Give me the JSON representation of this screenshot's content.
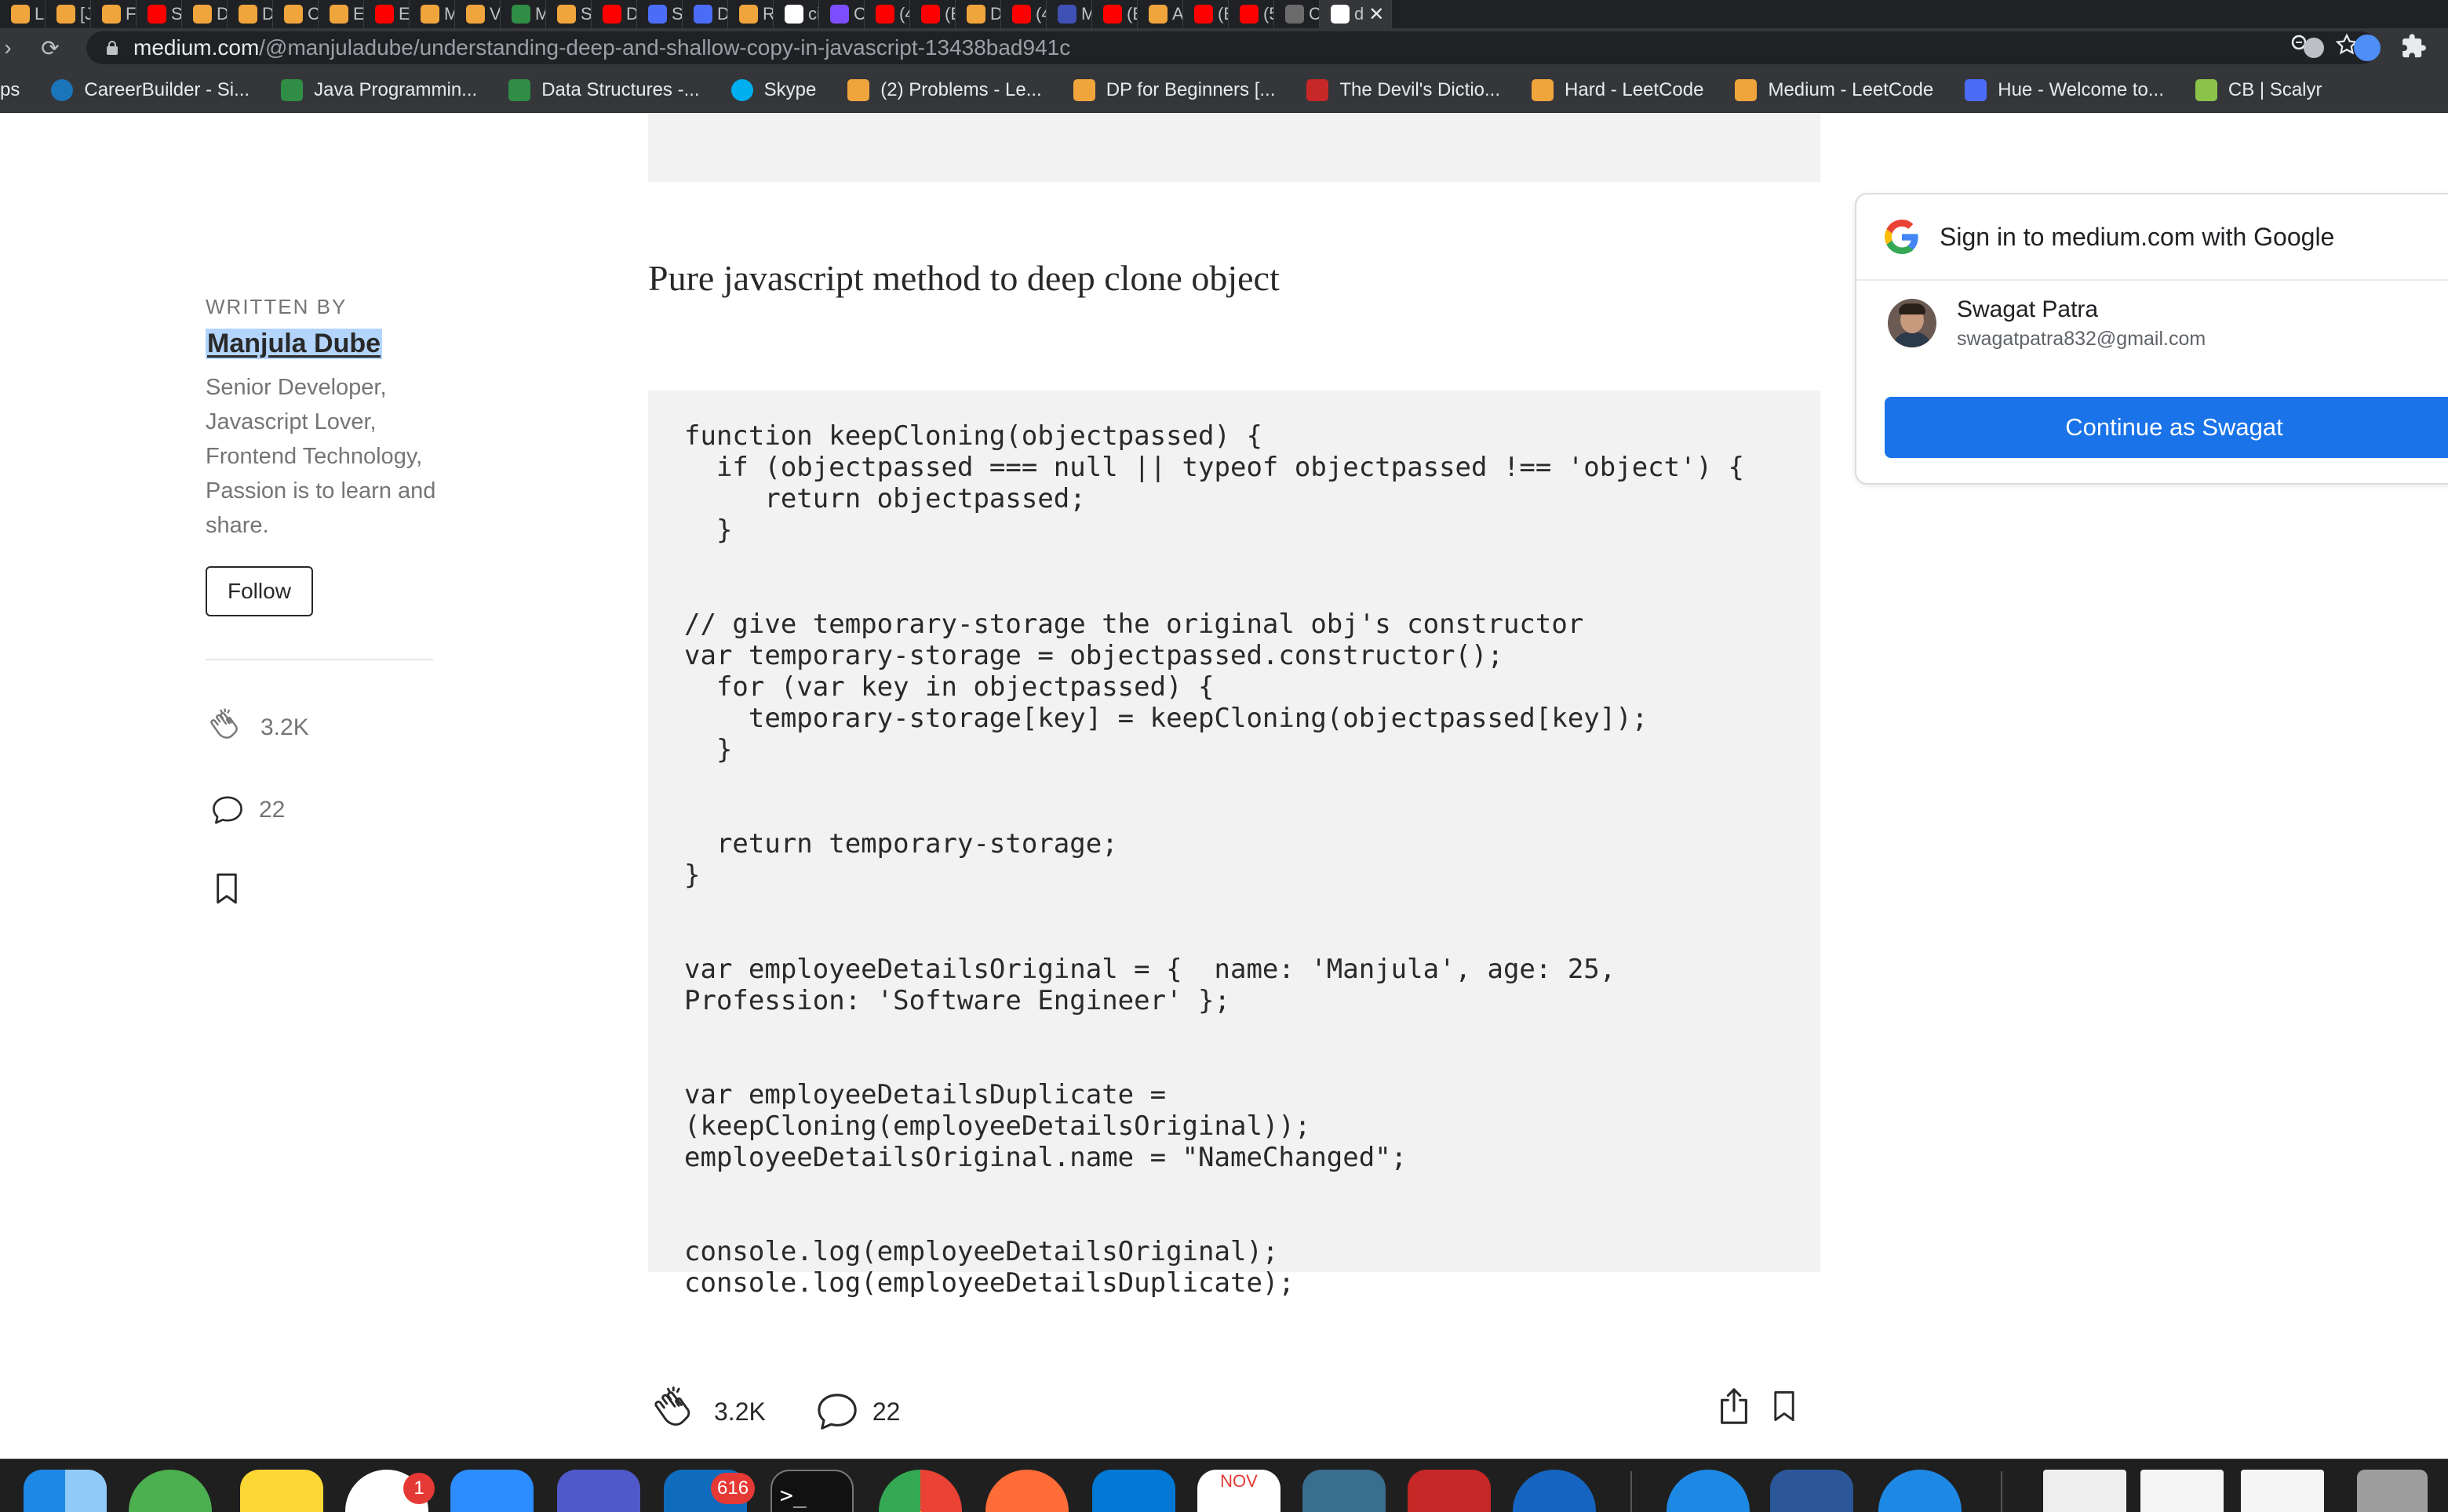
{
  "browser": {
    "tabs": [
      {
        "label": "LI",
        "color": "#f0a53c"
      },
      {
        "label": "[J",
        "color": "#f0a53c"
      },
      {
        "label": "Fi",
        "color": "#f0a53c"
      },
      {
        "label": "St",
        "color": "#ff0000"
      },
      {
        "label": "D",
        "color": "#f0a53c"
      },
      {
        "label": "D",
        "color": "#f0a53c"
      },
      {
        "label": "C",
        "color": "#f0a53c"
      },
      {
        "label": "Er",
        "color": "#f0a53c"
      },
      {
        "label": "Er",
        "color": "#ff0000"
      },
      {
        "label": "M",
        "color": "#f0a53c"
      },
      {
        "label": "Vi",
        "color": "#f0a53c"
      },
      {
        "label": "M",
        "color": "#2f8d46"
      },
      {
        "label": "Si",
        "color": "#f0a53c"
      },
      {
        "label": "D",
        "color": "#ff0000"
      },
      {
        "label": "Si",
        "color": "#4a6cf7"
      },
      {
        "label": "D",
        "color": "#4a6cf7"
      },
      {
        "label": "Ri",
        "color": "#f0a53c"
      },
      {
        "label": "ci",
        "color": "#ffffff"
      },
      {
        "label": "C",
        "color": "#7c4dff"
      },
      {
        "label": "(4",
        "color": "#ff0000"
      },
      {
        "label": "(E",
        "color": "#ff0000"
      },
      {
        "label": "D",
        "color": "#f0a53c"
      },
      {
        "label": "(4",
        "color": "#ff0000"
      },
      {
        "label": "M",
        "color": "#3f51b5"
      },
      {
        "label": "(E",
        "color": "#ff0000"
      },
      {
        "label": "A",
        "color": "#f0a53c"
      },
      {
        "label": "(E",
        "color": "#ff0000"
      },
      {
        "label": "(5",
        "color": "#ff0000"
      },
      {
        "label": "C",
        "color": "#6b6b6b"
      },
      {
        "label": "d",
        "color": "#ffffff"
      }
    ],
    "active_tab_close": "✕",
    "url_host": "medium.com",
    "url_path": "/@manjuladube/understanding-deep-and-shallow-copy-in-javascript-13438bad941c",
    "bookmarks": [
      {
        "label": "ps",
        "icon": "apps-icon",
        "color": ""
      },
      {
        "label": "CareerBuilder - Si...",
        "icon": "careerbuilder-icon",
        "color": "#1b75bb"
      },
      {
        "label": "Java Programmin...",
        "icon": "geeksforgeeks-icon",
        "color": "#2f8d46"
      },
      {
        "label": "Data Structures -...",
        "icon": "geeksforgeeks-icon",
        "color": "#2f8d46"
      },
      {
        "label": "Skype",
        "icon": "skype-icon",
        "color": "#00aff0"
      },
      {
        "label": "(2) Problems - Le...",
        "icon": "leetcode-icon",
        "color": "#f0a53c"
      },
      {
        "label": "DP for Beginners [...",
        "icon": "leetcode-icon",
        "color": "#f0a53c"
      },
      {
        "label": "The Devil's Dictio...",
        "icon": "devils-dictionary-icon",
        "color": "#c62828"
      },
      {
        "label": "Hard - LeetCode",
        "icon": "leetcode-icon",
        "color": "#f0a53c"
      },
      {
        "label": "Medium - LeetCode",
        "icon": "leetcode-icon",
        "color": "#f0a53c"
      },
      {
        "label": "Hue - Welcome to...",
        "icon": "hue-icon",
        "color": "#4a6cf7"
      },
      {
        "label": "CB | Scalyr",
        "icon": "scalyr-icon",
        "color": "#8bc34a"
      }
    ]
  },
  "article": {
    "subtitle": "Pure javascript method to deep clone object",
    "code": "function keepCloning(objectpassed) {\n  if (objectpassed === null || typeof objectpassed !== 'object') {\n     return objectpassed;\n  }\n\n\n// give temporary-storage the original obj's constructor\nvar temporary-storage = objectpassed.constructor();\n  for (var key in objectpassed) {\n    temporary-storage[key] = keepCloning(objectpassed[key]);\n  }\n\n\n  return temporary-storage;\n}\n\n\nvar employeeDetailsOriginal = {  name: 'Manjula', age: 25,\nProfession: 'Software Engineer' };\n\n\nvar employeeDetailsDuplicate =\n(keepCloning(employeeDetailsOriginal));\nemployeeDetailsOriginal.name = \"NameChanged\";\n\n\nconsole.log(employeeDetailsOriginal);\nconsole.log(employeeDetailsDuplicate);",
    "claps": "3.2K",
    "responses": "22"
  },
  "sidebar": {
    "written_by": "WRITTEN BY",
    "author": "Manjula Dube",
    "bio": "Senior Developer, Javascript Lover, Frontend Technology, Passion is to learn and share.",
    "follow_label": "Follow",
    "claps": "3.2K",
    "responses": "22"
  },
  "google_signin": {
    "title": "Sign in to medium.com with Google",
    "account_name": "Swagat Patra",
    "account_email": "swagatpatra832@gmail.com",
    "continue_label": "Continue as Swagat"
  },
  "dock": {
    "slack_badge": "1",
    "outlook_badge": "616",
    "calendar_month": "NOV",
    "terminal_prompt": ">_"
  },
  "colors": {
    "accent_blue": "#1a73e8",
    "code_bg": "#f2f2f2",
    "text_primary": "#292929",
    "text_muted": "#757575",
    "selection": "#b3d4fc"
  }
}
